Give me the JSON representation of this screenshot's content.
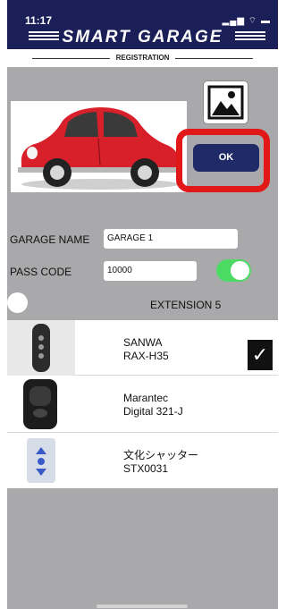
{
  "status": {
    "time": "11:17",
    "icons": "▂▄▆ ⌔ ▬"
  },
  "header": {
    "brand": "SMART GARAGE"
  },
  "registration": {
    "label": "REGISTRATION"
  },
  "actions": {
    "ok_label": "OK"
  },
  "form": {
    "garage_name_label": "GARAGE NAME",
    "garage_name_value": "GARAGE 1",
    "pass_code_label": "PASS CODE",
    "pass_code_value": "10000",
    "pass_toggle_on": true,
    "extension_label": "EXTENSION 5"
  },
  "remotes": [
    {
      "brand": "SANWA",
      "model": "RAX-H35",
      "selected": true,
      "icon": "remote-sanwa-image"
    },
    {
      "brand": "Marantec",
      "model": "Digital 321-J",
      "selected": false,
      "icon": "remote-marantec-image"
    },
    {
      "brand": "文化シャッター",
      "model": "STX0031",
      "selected": false,
      "icon": "remote-bunka-image"
    }
  ],
  "check_glyph": "✓",
  "colors": {
    "header": "#1a1f57",
    "ok_button": "#1f2a66",
    "highlight": "#e21818",
    "toggle_on": "#4cd964",
    "car": "#d8202a"
  }
}
